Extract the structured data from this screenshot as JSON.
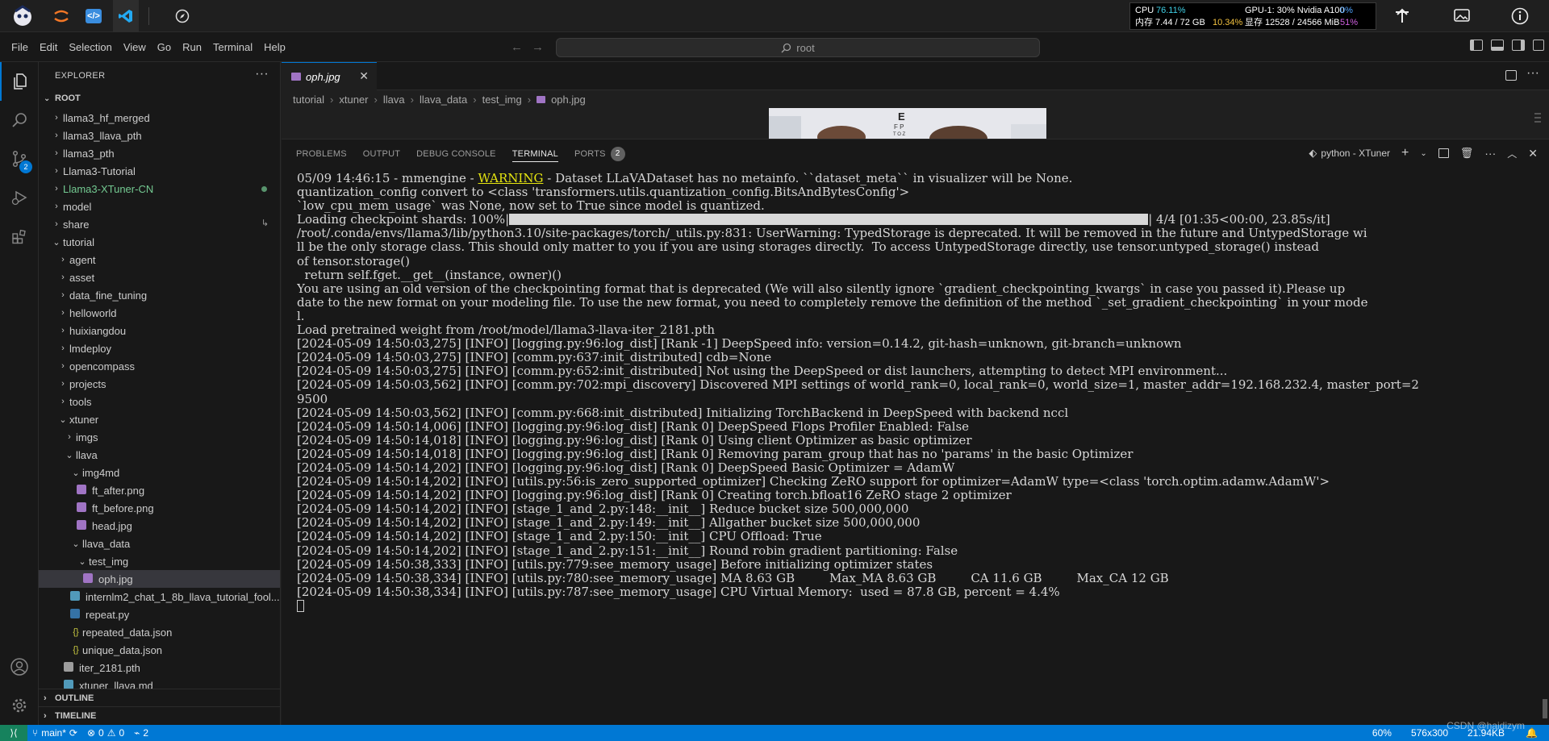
{
  "os_bar": {
    "cpu_label": "CPU",
    "cpu_value": "76.11%",
    "mem_label": "内存 7.44 / 72 GB",
    "mem_percent": "10.34%",
    "gpu_label": "GPU-1: 30% Nvidia A100",
    "gpu_percent": "0%",
    "vram_label": "显存 12528 / 24566 MiB",
    "vram_percent": "51%"
  },
  "menu": [
    "File",
    "Edit",
    "Selection",
    "View",
    "Go",
    "Run",
    "Terminal",
    "Help"
  ],
  "command_center": "root",
  "activity_badges": {
    "source_control": "2"
  },
  "explorer": {
    "title": "EXPLORER",
    "root": "ROOT",
    "items": [
      {
        "label": "llama3_hf_merged",
        "chev": "›"
      },
      {
        "label": "llama3_llava_pth",
        "chev": "›"
      },
      {
        "label": "llama3_pth",
        "chev": "›"
      },
      {
        "label": "Llama3-Tutorial",
        "chev": "›"
      },
      {
        "label": "Llama3-XTuner-CN",
        "chev": "›"
      },
      {
        "label": "model",
        "chev": "›"
      },
      {
        "label": "share",
        "chev": "›"
      },
      {
        "label": "tutorial",
        "chev": "⌄"
      },
      {
        "label": "agent",
        "chev": "›"
      },
      {
        "label": "asset",
        "chev": "›"
      },
      {
        "label": "data_fine_tuning",
        "chev": "›"
      },
      {
        "label": "helloworld",
        "chev": "›"
      },
      {
        "label": "huixiangdou",
        "chev": "›"
      },
      {
        "label": "lmdeploy",
        "chev": "›"
      },
      {
        "label": "opencompass",
        "chev": "›"
      },
      {
        "label": "projects",
        "chev": "›"
      },
      {
        "label": "tools",
        "chev": "›"
      },
      {
        "label": "xtuner",
        "chev": "⌄"
      },
      {
        "label": "imgs",
        "chev": "›"
      },
      {
        "label": "llava",
        "chev": "⌄"
      },
      {
        "label": "img4md",
        "chev": "⌄"
      },
      {
        "label": "ft_after.png"
      },
      {
        "label": "ft_before.png"
      },
      {
        "label": "head.jpg"
      },
      {
        "label": "llava_data",
        "chev": "⌄"
      },
      {
        "label": "test_img",
        "chev": "⌄"
      },
      {
        "label": "oph.jpg"
      },
      {
        "label": "internlm2_chat_1_8b_llava_tutorial_fool..."
      },
      {
        "label": "repeat.py"
      },
      {
        "label": "repeated_data.json",
        "chev": "{}"
      },
      {
        "label": "unique_data.json",
        "chev": "{}"
      },
      {
        "label": "iter_2181.pth"
      },
      {
        "label": "xtuner_llava.md"
      }
    ],
    "outline": "OUTLINE",
    "timeline": "TIMELINE"
  },
  "editor": {
    "tab_label": "oph.jpg",
    "breadcrumb": [
      "tutorial",
      "xtuner",
      "llava",
      "llava_data",
      "test_img",
      "oph.jpg"
    ]
  },
  "panel": {
    "tabs": [
      "PROBLEMS",
      "OUTPUT",
      "DEBUG CONSOLE",
      "TERMINAL",
      "PORTS"
    ],
    "ports_count": "2",
    "terminal_name": "python - XTuner"
  },
  "terminal": {
    "line1_prefix": "05/09 14:46:15 - mmengine - ",
    "line1_warn": "WARNING",
    "line1_suffix": " - Dataset LLaVADataset has no metainfo. ``dataset_meta`` in visualizer will be None.",
    "line2": "quantization_config convert to <class 'transformers.utils.quantization_config.BitsAndBytesConfig'>",
    "line3": "`low_cpu_mem_usage` was None, now set to True since model is quantized.",
    "progress_prefix": "Loading checkpoint shards: 100%|",
    "progress_suffix": "| 4/4 [01:35<00:00, 23.85s/it]",
    "rest": [
      "/root/.conda/envs/llama3/lib/python3.10/site-packages/torch/_utils.py:831: UserWarning: TypedStorage is deprecated. It will be removed in the future and UntypedStorage wi",
      "ll be the only storage class. This should only matter to you if you are using storages directly.  To access UntypedStorage directly, use tensor.untyped_storage() instead",
      "of tensor.storage()",
      "  return self.fget.__get__(instance, owner)()",
      "You are using an old version of the checkpointing format that is deprecated (We will also silently ignore `gradient_checkpointing_kwargs` in case you passed it).Please up",
      "date to the new format on your modeling file. To use the new format, you need to completely remove the definition of the method `_set_gradient_checkpointing` in your mode",
      "l.",
      "Load pretrained weight from /root/model/llama3-llava-iter_2181.pth",
      "[2024-05-09 14:50:03,275] [INFO] [logging.py:96:log_dist] [Rank -1] DeepSpeed info: version=0.14.2, git-hash=unknown, git-branch=unknown",
      "[2024-05-09 14:50:03,275] [INFO] [comm.py:637:init_distributed] cdb=None",
      "[2024-05-09 14:50:03,275] [INFO] [comm.py:652:init_distributed] Not using the DeepSpeed or dist launchers, attempting to detect MPI environment...",
      "[2024-05-09 14:50:03,562] [INFO] [comm.py:702:mpi_discovery] Discovered MPI settings of world_rank=0, local_rank=0, world_size=1, master_addr=192.168.232.4, master_port=2",
      "9500",
      "[2024-05-09 14:50:03,562] [INFO] [comm.py:668:init_distributed] Initializing TorchBackend in DeepSpeed with backend nccl",
      "[2024-05-09 14:50:14,006] [INFO] [logging.py:96:log_dist] [Rank 0] DeepSpeed Flops Profiler Enabled: False",
      "[2024-05-09 14:50:14,018] [INFO] [logging.py:96:log_dist] [Rank 0] Using client Optimizer as basic optimizer",
      "[2024-05-09 14:50:14,018] [INFO] [logging.py:96:log_dist] [Rank 0] Removing param_group that has no 'params' in the basic Optimizer",
      "[2024-05-09 14:50:14,202] [INFO] [logging.py:96:log_dist] [Rank 0] DeepSpeed Basic Optimizer = AdamW",
      "[2024-05-09 14:50:14,202] [INFO] [utils.py:56:is_zero_supported_optimizer] Checking ZeRO support for optimizer=AdamW type=<class 'torch.optim.adamw.AdamW'>",
      "[2024-05-09 14:50:14,202] [INFO] [logging.py:96:log_dist] [Rank 0] Creating torch.bfloat16 ZeRO stage 2 optimizer",
      "[2024-05-09 14:50:14,202] [INFO] [stage_1_and_2.py:148:__init__] Reduce bucket size 500,000,000",
      "[2024-05-09 14:50:14,202] [INFO] [stage_1_and_2.py:149:__init__] Allgather bucket size 500,000,000",
      "[2024-05-09 14:50:14,202] [INFO] [stage_1_and_2.py:150:__init__] CPU Offload: True",
      "[2024-05-09 14:50:14,202] [INFO] [stage_1_and_2.py:151:__init__] Round robin gradient partitioning: False",
      "[2024-05-09 14:50:38,333] [INFO] [utils.py:779:see_memory_usage] Before initializing optimizer states",
      "[2024-05-09 14:50:38,334] [INFO] [utils.py:780:see_memory_usage] MA 8.63 GB         Max_MA 8.63 GB         CA 11.6 GB         Max_CA 12 GB",
      "[2024-05-09 14:50:38,334] [INFO] [utils.py:787:see_memory_usage] CPU Virtual Memory:  used = 87.8 GB, percent = 4.4%"
    ]
  },
  "status_bar": {
    "branch": "main*",
    "errors": "0",
    "warnings": "0",
    "ports": "2",
    "zoom": "60%",
    "dims": "576x300",
    "size": "21.94KB"
  },
  "watermark": "CSDN @haidizym",
  "colors": {
    "accent": "#0078d4",
    "git_untracked": "#73c991",
    "status_bar": "#0078d4"
  }
}
